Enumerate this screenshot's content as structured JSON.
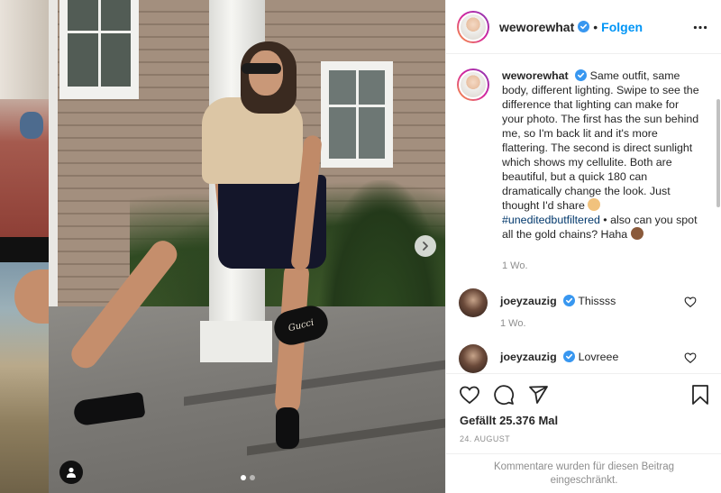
{
  "post": {
    "username": "weworewhat",
    "follow_label": "Folgen",
    "separator": "•",
    "bag_logo_text": "Gucci",
    "carousel": {
      "current": 1,
      "total": 2
    }
  },
  "caption": {
    "username": "weworewhat",
    "text_before": " Same outfit, same body, different lighting. Swipe to see the difference that lighting can make for your photo. The first has the sun behind me, so I'm back lit and it's more flattering. The second is direct sunlight which shows my cellulite. Both are beautiful, but a quick 180 can dramatically change the look. Just thought I'd share ",
    "hashtag": "#uneditedbutfiltered",
    "text_after": " • also can you spot all the gold chains? Haha ",
    "time": "1 Wo."
  },
  "comments": [
    {
      "username": "joeyzauzig",
      "text": "Thissss",
      "time": "1 Wo."
    },
    {
      "username": "joeyzauzig",
      "text": "Lovreee",
      "time": ""
    }
  ],
  "stats": {
    "likes": "Gefällt 25.376 Mal",
    "date": "24. AUGUST",
    "comments_disabled": "Kommentare wurden für diesen Beitrag eingeschränkt."
  },
  "icons": {
    "verified": "verified-badge-icon",
    "more": "more-options-icon",
    "like": "heart-icon",
    "comment": "comment-bubble-icon",
    "share": "paper-plane-icon",
    "save": "bookmark-icon",
    "next": "chevron-right-icon",
    "tag": "user-tag-icon"
  },
  "colors": {
    "accent": "#0095f6",
    "verified": "#3897f0",
    "hashtag": "#00376b",
    "muted": "#8e8e8e",
    "text": "#262626"
  }
}
